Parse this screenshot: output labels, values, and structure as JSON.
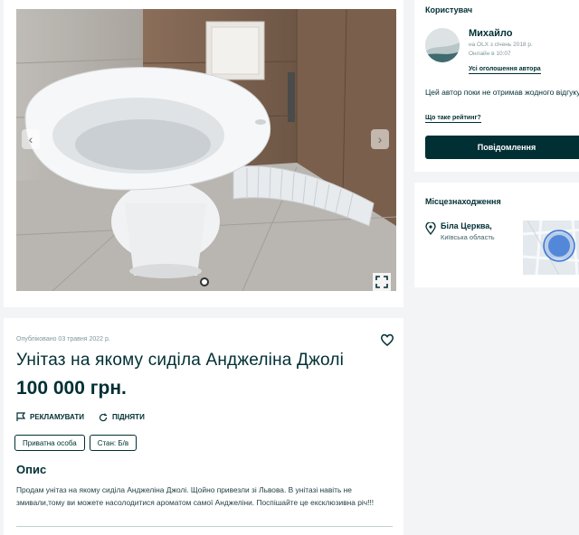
{
  "gallery": {
    "prev_icon": "chevron-left-icon",
    "next_icon": "chevron-right-icon",
    "expand_icon": "expand-icon"
  },
  "listing": {
    "posted": "Опубліковано 03 травня 2022 р.",
    "title": "Унітаз на якому сиділа Анджеліна Джолі",
    "price": "100 000 грн.",
    "actions": {
      "promote": "РЕКЛАМУВАТИ",
      "raise": "ПІДНЯТИ"
    },
    "tags": [
      "Приватна особа",
      "Стан: Б/в"
    ],
    "description_heading": "Опис",
    "description": "Продам унітаз на якому сиділа Анджеліна Джолі. Щойно привезли зі Львова. В унітазі навіть не змивали,тому ви можете насолодитися ароматом самої Анджеліни. Поспішайте це ексклюзивна річ!!!"
  },
  "user": {
    "section_title": "Користувач",
    "name": "Михайло",
    "member_since": "на OLX з січень 2018 р.",
    "online": "Онлайн в 10:07",
    "all_ads_link": "Усі оголошення автора",
    "no_rating": "Цей автор поки не отримав жодного відгуку",
    "rating_link": "Що таке рейтинг?",
    "message_button": "Повідомлення"
  },
  "location": {
    "section_title": "Місцезнаходження",
    "city": "Біла Церква,",
    "region": "Київська область"
  },
  "colors": {
    "brand": "#002f34",
    "map_marker": "#3a77d6"
  }
}
